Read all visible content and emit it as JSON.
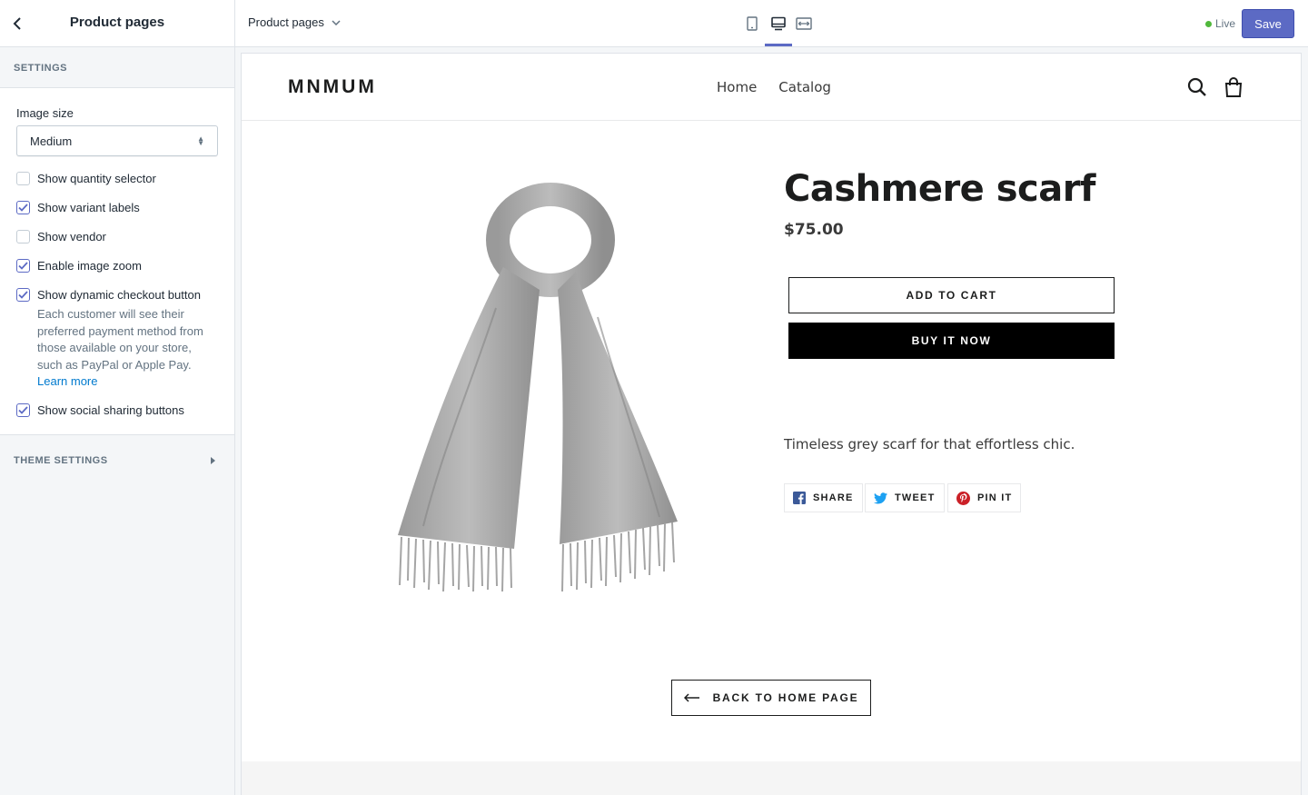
{
  "sidebar": {
    "title": "Product pages",
    "section_title": "SETTINGS",
    "image_size_label": "Image size",
    "image_size_value": "Medium",
    "options": [
      {
        "label": "Show quantity selector",
        "checked": false
      },
      {
        "label": "Show variant labels",
        "checked": true
      },
      {
        "label": "Show vendor",
        "checked": false
      },
      {
        "label": "Enable image zoom",
        "checked": true
      },
      {
        "label": "Show dynamic checkout button",
        "checked": true
      },
      {
        "label": "Show social sharing buttons",
        "checked": true
      }
    ],
    "checkout_help": "Each customer will see their preferred payment method from those available on your store, such as PayPal or Apple Pay.",
    "learn_more": "Learn more",
    "theme_settings": "THEME SETTINGS"
  },
  "topbar": {
    "page_select": "Product pages",
    "devices": [
      "mobile-icon",
      "desktop-icon",
      "fullscreen-icon"
    ],
    "active_device": "desktop-icon",
    "live_label": "Live",
    "save_label": "Save"
  },
  "store": {
    "logo": "MNMUM",
    "nav": [
      "Home",
      "Catalog"
    ],
    "product": {
      "title": "Cashmere scarf",
      "price": "$75.00",
      "add_to_cart": "ADD TO CART",
      "buy_now": "BUY IT NOW",
      "description": "Timeless grey scarf for that effortless chic."
    },
    "share": {
      "facebook": "SHARE",
      "twitter": "TWEET",
      "pinterest": "PIN IT"
    },
    "back_home": "BACK TO HOME PAGE"
  },
  "colors": {
    "accent": "#5c6ac4",
    "live": "#50b83c",
    "link": "#007ace"
  }
}
